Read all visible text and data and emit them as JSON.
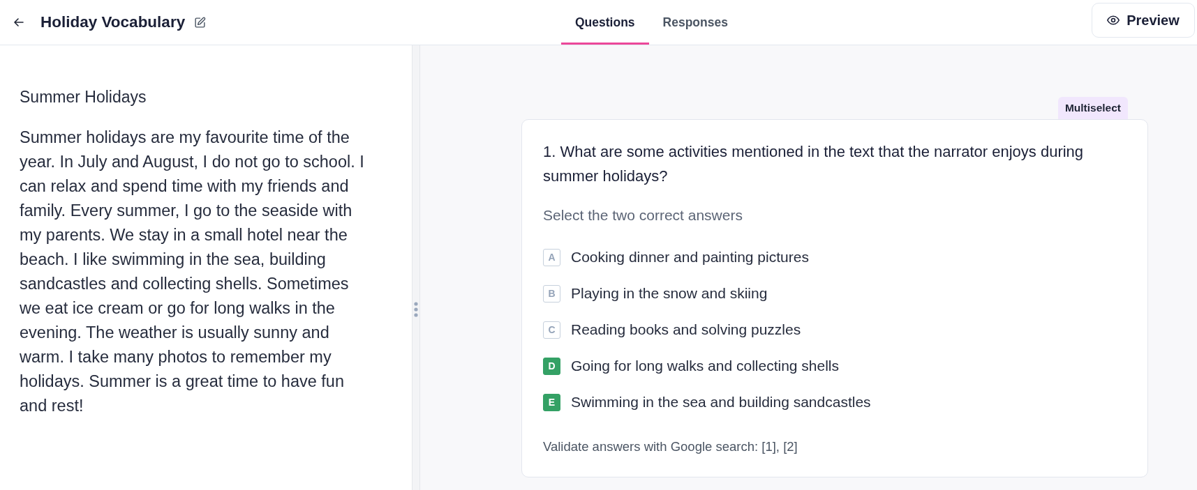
{
  "header": {
    "title": "Holiday Vocabulary"
  },
  "tabs": [
    {
      "label": "Questions",
      "selected": true
    },
    {
      "label": "Responses",
      "selected": false
    }
  ],
  "preview_button": {
    "label": "Preview"
  },
  "passage": {
    "title": "Summer Holidays",
    "text": "Summer holidays are my favourite time of the year. In July and August, I do not go to school. I can relax and spend time with my friends and family. Every summer, I go to the seaside with my parents. We stay in a small hotel near the beach. I like swimming in the sea, building sandcastles and collecting shells. Sometimes we eat ice cream or go for long walks in the evening. The weather is usually sunny and warm. I take many photos to remember my holidays. Summer is a great time to have fun and rest!"
  },
  "question": {
    "type_badge": "Multiselect",
    "prompt": "1. What are some activities mentioned in the text that the narrator enjoys during summer holidays?",
    "instruction": "Select the two correct answers",
    "options": [
      {
        "letter": "A",
        "text": "Cooking dinner and painting pictures",
        "correct": false
      },
      {
        "letter": "B",
        "text": "Playing in the snow and skiing",
        "correct": false
      },
      {
        "letter": "C",
        "text": "Reading books and solving puzzles",
        "correct": false
      },
      {
        "letter": "D",
        "text": "Going for long walks and collecting shells",
        "correct": true
      },
      {
        "letter": "E",
        "text": "Swimming in the sea and building sandcastles",
        "correct": true
      }
    ],
    "sources_note": "Validate answers with Google search: [1], [2]"
  }
}
